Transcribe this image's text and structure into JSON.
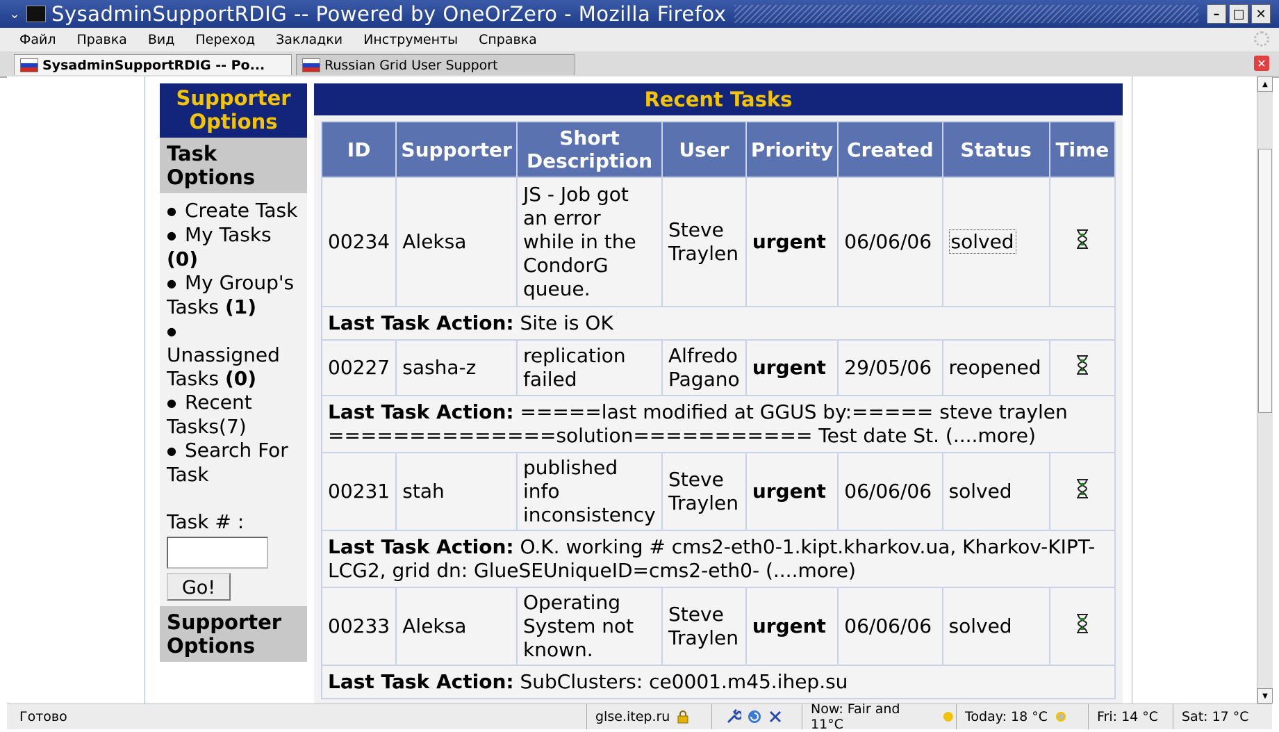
{
  "window": {
    "title": "SysadminSupportRDIG -- Powered by OneOrZero - Mozilla Firefox"
  },
  "menu": {
    "items": [
      "Файл",
      "Правка",
      "Вид",
      "Переход",
      "Закладки",
      "Инструменты",
      "Справка"
    ]
  },
  "tabs": [
    {
      "label": "SysadminSupportRDIG -- Po...",
      "active": true
    },
    {
      "label": "Russian Grid User Support",
      "active": false
    }
  ],
  "sidebar": {
    "header": "Supporter Options",
    "task_options_title": "Task Options",
    "create_task": "Create Task",
    "my_tasks": "My Tasks",
    "my_tasks_count": "(0)",
    "my_group_tasks": "My Group's Tasks",
    "my_group_tasks_count": "(1)",
    "unassigned_tasks": "Unassigned Tasks",
    "unassigned_tasks_count": "(0)",
    "recent_tasks": "Recent Tasks(7)",
    "search_task": "Search For Task",
    "task_number_label": "Task # :",
    "task_number_value": "",
    "go_label": "Go!",
    "footer_section": "Supporter Options"
  },
  "main": {
    "title": "Recent Tasks",
    "columns": [
      "ID",
      "Supporter",
      "Short Description",
      "User",
      "Priority",
      "Created",
      "Status",
      "Time"
    ],
    "last_action_label": "Last Task Action:",
    "rows": [
      {
        "id": "00234",
        "supporter": "Aleksa",
        "description": "JS - Job got an error while in the CondorG queue.",
        "user": "Steve Traylen",
        "priority": "urgent",
        "created": "06/06/06",
        "status": "solved",
        "time_icon": "hourglass-icon",
        "last_action": "Site is OK"
      },
      {
        "id": "00227",
        "supporter": "sasha-z",
        "description": "replication failed",
        "user": "Alfredo Pagano",
        "priority": "urgent",
        "created": "29/05/06",
        "status": "reopened",
        "time_icon": "hourglass-icon",
        "last_action": "=====last modified at GGUS by:===== steve traylen ==============solution=========== Test date St. (....more)"
      },
      {
        "id": "00231",
        "supporter": "stah",
        "description": "published info inconsistency",
        "user": "Steve Traylen",
        "priority": "urgent",
        "created": "06/06/06",
        "status": "solved",
        "time_icon": "hourglass-icon",
        "last_action": "O.K. working # cms2-eth0-1.kipt.kharkov.ua, Kharkov-KIPT-LCG2, grid dn: GlueSEUniqueID=cms2-eth0- (....more)"
      },
      {
        "id": "00233",
        "supporter": "Aleksa",
        "description": "Operating System not known.",
        "user": "Steve Traylen",
        "priority": "urgent",
        "created": "06/06/06",
        "status": "solved",
        "time_icon": "hourglass-icon",
        "last_action": "SubClusters: ce0001.m45.ihep.su"
      }
    ]
  },
  "statusbar": {
    "status": "Готово",
    "host": "glse.itep.ru",
    "weather_now": "Now: Fair and 11°C",
    "weather_today": "Today: 18 °C",
    "weather_fri": "Fri: 14 °C",
    "weather_sat": "Sat: 17 °C"
  },
  "colors": {
    "header_bg": "#12257a",
    "header_text": "#f5c400",
    "table_header": "#5a72b0"
  }
}
